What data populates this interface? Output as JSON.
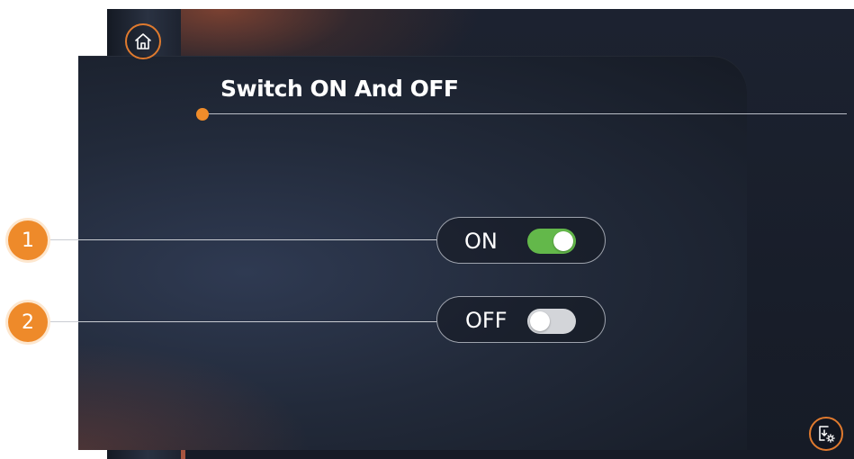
{
  "header": {
    "title": "Switch ON And OFF"
  },
  "navigation": {
    "home_icon": "home-icon",
    "settings_icon": "download-settings-icon"
  },
  "toggles": [
    {
      "callout": "1",
      "label": "ON",
      "state": "on"
    },
    {
      "callout": "2",
      "label": "OFF",
      "state": "off"
    }
  ],
  "colors": {
    "accent": "#ee8a2a",
    "switch_on": "#63b84a",
    "switch_off": "#d3d5d9",
    "background": "#1c2230"
  }
}
